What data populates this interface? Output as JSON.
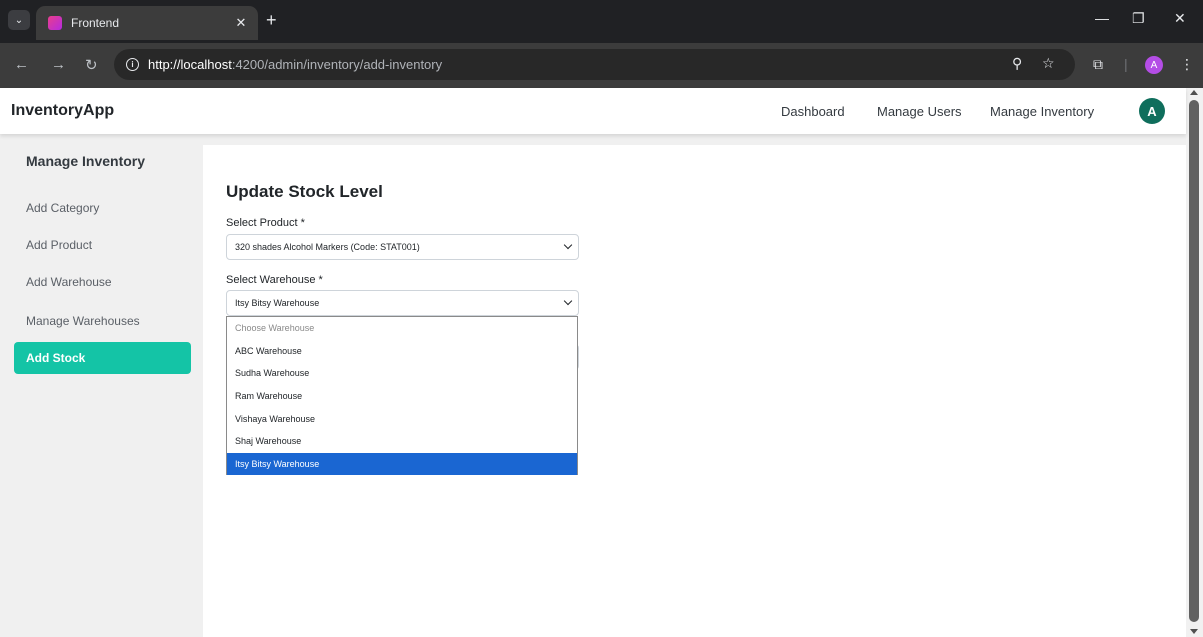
{
  "browser": {
    "tab_title": "Frontend",
    "url_host": "http://localhost",
    "url_rest": ":4200/admin/inventory/add-inventory",
    "profile_initial": "A"
  },
  "header": {
    "brand": "InventoryApp",
    "nav": [
      "Dashboard",
      "Manage Users",
      "Manage Inventory"
    ],
    "avatar_initial": "A"
  },
  "sidebar": {
    "title": "Manage Inventory",
    "items": [
      {
        "label": "Add Category",
        "active": false
      },
      {
        "label": "Add Product",
        "active": false
      },
      {
        "label": "Add Warehouse",
        "active": false
      },
      {
        "label": "Manage Warehouses",
        "active": false
      },
      {
        "label": "Add Stock",
        "active": true
      }
    ]
  },
  "form": {
    "title": "Update Stock Level",
    "product_label": "Select Product *",
    "product_value": "320 shades Alcohol Markers (Code: STAT001)",
    "warehouse_label": "Select Warehouse *",
    "warehouse_value": "Itsy Bitsy Warehouse"
  },
  "warehouse_options": [
    "Choose Warehouse",
    "ABC Warehouse",
    "Sudha Warehouse",
    "Ram Warehouse",
    "Vishaya Warehouse",
    "Shaj Warehouse",
    "Itsy Bitsy Warehouse"
  ],
  "colors": {
    "accent": "#14c4a6",
    "selected_option": "#1a66d2",
    "avatar": "#0f6e5c"
  }
}
